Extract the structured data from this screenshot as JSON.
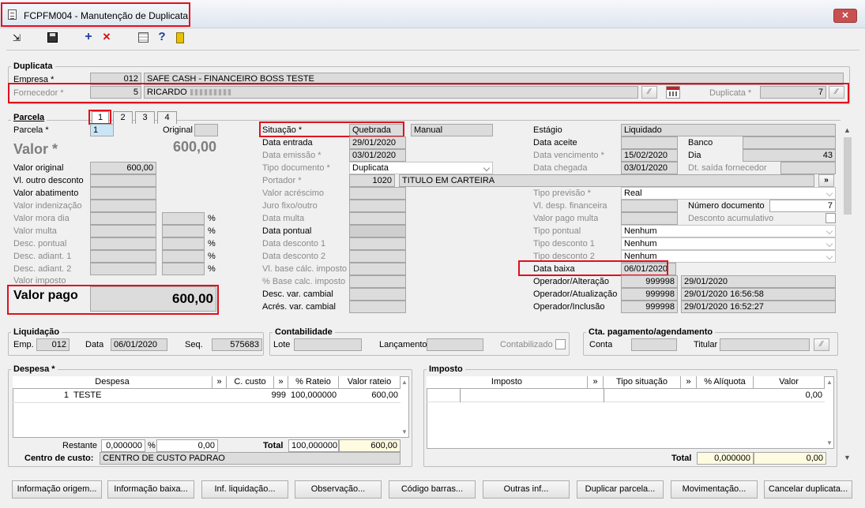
{
  "window": {
    "title": "FCPFM004 - Manutenção de Duplicata",
    "close": "✕"
  },
  "toolbar": {
    "add": "+",
    "cancel": "✕",
    "help": "?"
  },
  "duplicata": {
    "title": "Duplicata",
    "empresa_label": "Empresa *",
    "empresa_code": "012",
    "empresa_name": "SAFE CASH - FINANCEIRO BOSS TESTE",
    "fornecedor_label": "Fornecedor *",
    "fornecedor_code": "5",
    "fornecedor_name": "RICARDO",
    "duplicata_label": "Duplicata *",
    "duplicata_value": "7"
  },
  "parcela": {
    "title": "Parcela",
    "tabs": [
      "1",
      "2",
      "3",
      "4"
    ],
    "parcela_label": "Parcela *",
    "parcela_value": "1",
    "original_label": "Original",
    "valor_label": "Valor *",
    "valor_value": "600,00"
  },
  "left": {
    "valor_original": "Valor original",
    "valor_original_value": "600,00",
    "vl_outro_desconto": "Vl. outro desconto",
    "valor_abatimento": "Valor abatimento",
    "valor_indenizacao": "Valor indenização",
    "valor_mora_dia": "Valor mora dia",
    "valor_multa": "Valor multa",
    "desc_pontual": "Desc. pontual",
    "desc_adiant1": "Desc. adiant. 1",
    "desc_adiant2": "Desc. adiant. 2",
    "valor_imposto": "Valor imposto",
    "pct": "%",
    "valor_pago_label": "Valor pago",
    "valor_pago_value": "600,00"
  },
  "mid": {
    "situacao_label": "Situação *",
    "situacao_value": "Quebrada",
    "manual": "Manual",
    "data_entrada": "Data entrada",
    "data_entrada_value": "29/01/2020",
    "data_emissao": "Data emissão *",
    "data_emissao_value": "03/01/2020",
    "tipo_documento": "Tipo documento *",
    "tipo_documento_value": "Duplicata",
    "portador": "Portador *",
    "portador_code": "1020",
    "portador_name": "TITULO EM CARTEIRA",
    "valor_acrescimo": "Valor acréscimo",
    "juro_fixo": "Juro fixo/outro",
    "data_multa": "Data multa",
    "data_pontual": "Data pontual",
    "data_desconto1": "Data desconto 1",
    "data_desconto2": "Data desconto 2",
    "vl_base_calc": "Vl. base cálc. imposto",
    "pct_base_calc": "% Base calc. imposto",
    "desc_var_cambial": "Desc. var. cambial",
    "acres_var_cambial": "Acrés. var. cambial"
  },
  "right": {
    "estagio": "Estágio",
    "estagio_value": "Liquidado",
    "data_aceite": "Data aceite",
    "banco": "Banco",
    "data_vencimento": "Data vencimento *",
    "data_vencimento_value": "15/02/2020",
    "dia": "Dia",
    "dia_value": "43",
    "data_chegada": "Data chegada",
    "data_chegada_value": "03/01/2020",
    "dt_saida": "Dt. saída fornecedor",
    "tipo_previsao": "Tipo previsão *",
    "tipo_previsao_value": "Real",
    "vl_desp_financeira": "Vl. desp. financeira",
    "numero_documento": "Número documento",
    "numero_documento_value": "7",
    "valor_pago_multa": "Valor pago multa",
    "desconto_acumulativo": "Desconto acumulativo",
    "tipo_pontual": "Tipo pontual",
    "tipo_desconto1": "Tipo desconto 1",
    "tipo_desconto2": "Tipo desconto 2",
    "nenhum": "Nenhum",
    "data_baixa": "Data baixa",
    "data_baixa_value": "06/01/2020",
    "op_alteracao": "Operador/Alteração",
    "op_atualizacao": "Operador/Atualização",
    "op_inclusao": "Operador/Inclusão",
    "operador": "999998",
    "op_alteracao_date": "29/01/2020",
    "op_atualizacao_date": "29/01/2020 16:56:58",
    "op_inclusao_date": "29/01/2020 16:52:27"
  },
  "liquidacao": {
    "title": "Liquidação",
    "emp": "Emp.",
    "emp_value": "012",
    "data": "Data",
    "data_value": "06/01/2020",
    "seq": "Seq.",
    "seq_value": "575683"
  },
  "contabilidade": {
    "title": "Contabilidade",
    "lote": "Lote",
    "lancamento": "Lançamento",
    "contabilizado": "Contabilizado"
  },
  "cta": {
    "title": "Cta. pagamento/agendamento",
    "conta": "Conta",
    "titular": "Titular"
  },
  "despesa": {
    "title": "Despesa *",
    "columns": [
      "Despesa",
      "»",
      "C. custo",
      "»",
      "% Rateio",
      "Valor rateio"
    ],
    "row": {
      "num": "1",
      "despesa": "TESTE",
      "ccusto": "999",
      "rateio": "100,000000",
      "valor": "600,00"
    },
    "restante": "Restante",
    "restante_value": "0,000000",
    "pct": "%",
    "restante_valor": "0,00",
    "total": "Total",
    "total_rateio": "100,000000",
    "total_valor": "600,00",
    "centro_label": "Centro de custo:",
    "centro_value": "CENTRO DE CUSTO PADRAO"
  },
  "imposto": {
    "title": "Imposto",
    "columns": [
      "Imposto",
      "»",
      "Tipo situação",
      "»",
      "% Alíquota",
      "Valor"
    ],
    "row_valor": "0,00",
    "total": "Total",
    "total_aliquota": "0,000000",
    "total_valor": "0,00"
  },
  "buttons": [
    "Informação origem...",
    "Informação baixa...",
    "Inf. liquidação...",
    "Observação...",
    "Código barras...",
    "Outras inf...",
    "Duplicar parcela...",
    "Movimentação...",
    "Cancelar duplicata..."
  ]
}
